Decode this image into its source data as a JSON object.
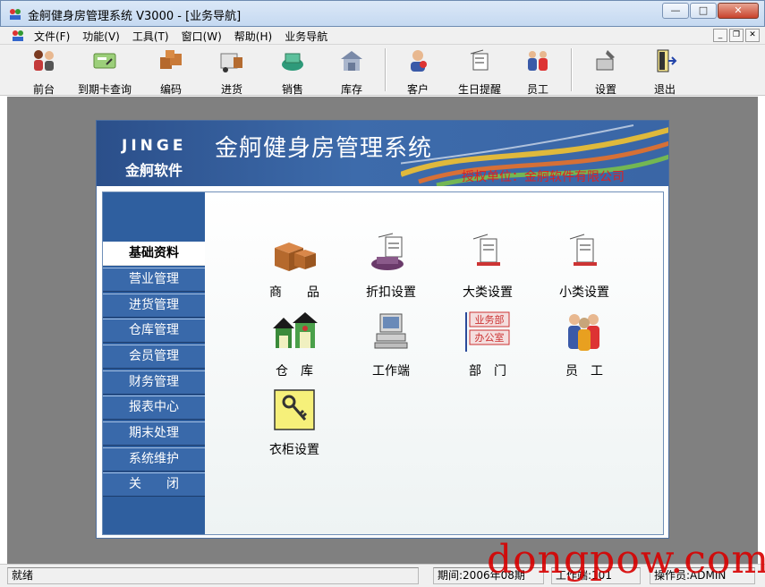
{
  "window": {
    "title": "金舸健身房管理系统 V3000 - [业务导航]",
    "minimize_icon": "minimize-icon",
    "maximize_icon": "maximize-icon",
    "close_icon": "close-icon"
  },
  "menubar": {
    "items": [
      "文件(F)",
      "功能(V)",
      "工具(T)",
      "窗口(W)",
      "帮助(H)",
      "业务导航"
    ]
  },
  "toolbar": {
    "buttons": [
      {
        "label": "前台",
        "icon": "people-icon"
      },
      {
        "label": "到期卡查询",
        "icon": "card-query-icon"
      },
      {
        "label": "编码",
        "icon": "boxes-icon"
      },
      {
        "label": "进货",
        "icon": "purchase-icon"
      },
      {
        "label": "销售",
        "icon": "money-icon"
      },
      {
        "label": "库存",
        "icon": "warehouse-icon"
      },
      {
        "label": "客户",
        "icon": "customer-icon"
      },
      {
        "label": "生日提醒",
        "icon": "birthday-icon"
      },
      {
        "label": "员工",
        "icon": "staff-icon"
      },
      {
        "label": "设置",
        "icon": "settings-icon"
      },
      {
        "label": "退出",
        "icon": "exit-door-icon"
      }
    ]
  },
  "banner": {
    "logo_en": "JINGE",
    "logo_cn": "金舸软件",
    "title": "金舸健身房管理系统",
    "licensed_to": "授权单位：金舸软件有限公司"
  },
  "sidenav": {
    "items": [
      "基础资料",
      "营业管理",
      "进货管理",
      "仓库管理",
      "会员管理",
      "财务管理",
      "报表中心",
      "期末处理",
      "系统维护",
      "关　　闭"
    ],
    "active_index": 0
  },
  "tiles": [
    {
      "label": "商　　品",
      "icon": "goods-boxes-icon"
    },
    {
      "label": "折扣设置",
      "icon": "discount-settings-icon"
    },
    {
      "label": "大类设置",
      "icon": "category-settings-icon"
    },
    {
      "label": "小类设置",
      "icon": "subcategory-settings-icon"
    },
    {
      "label": "仓　库",
      "icon": "warehouse-house-icon"
    },
    {
      "label": "工作端",
      "icon": "workstation-computer-icon"
    },
    {
      "label": "部　门",
      "icon": "department-sign-icon"
    },
    {
      "label": "员　工",
      "icon": "employees-icon"
    },
    {
      "label": "衣柜设置",
      "icon": "locker-key-icon"
    }
  ],
  "department_sign": {
    "line1": "业务部",
    "line2": "办公室"
  },
  "statusbar": {
    "status": "就绪",
    "period": "期间:2006年08期",
    "workstation": "工作端:101",
    "operator": "操作员:ADMIN"
  },
  "watermark": "dongpow.com",
  "colors": {
    "nav_bg": "#3969aa",
    "banner_bg": "#2b4f8a",
    "client_bg": "#808080",
    "licensed_text": "#e02020",
    "watermark": "#d80000"
  }
}
